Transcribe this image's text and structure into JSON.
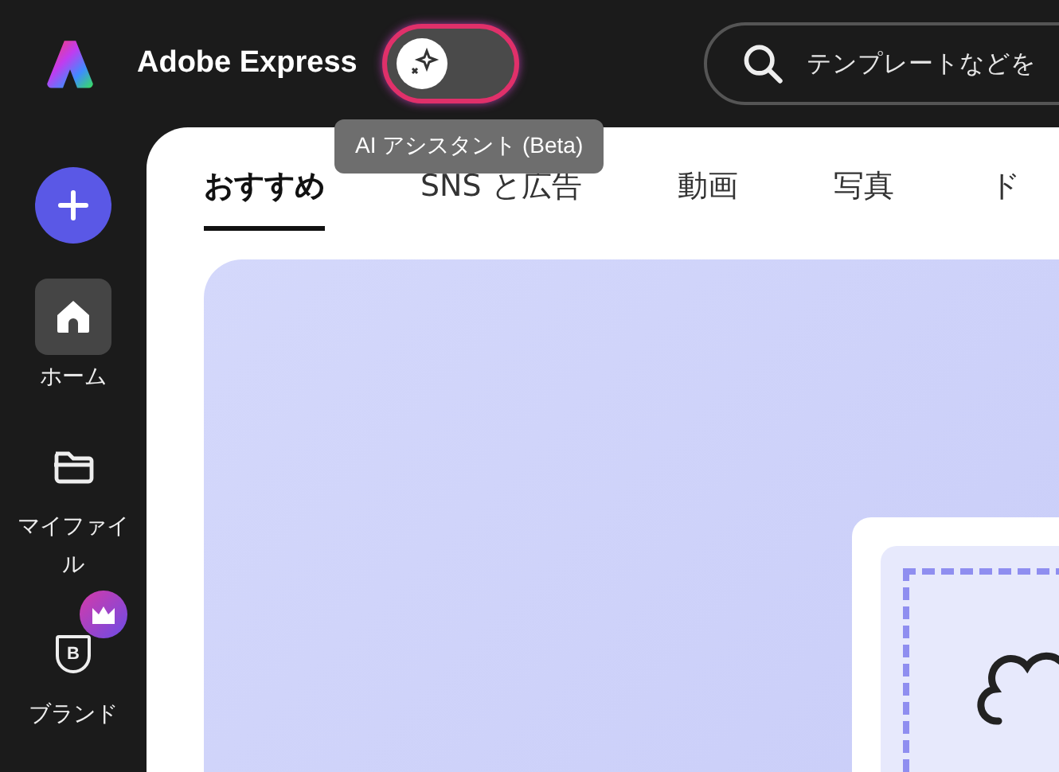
{
  "header": {
    "app_name": "Adobe Express",
    "ai_toggle": {
      "on": false
    },
    "ai_tooltip": "AI アシスタント (Beta)",
    "search": {
      "placeholder": "テンプレートなどを"
    }
  },
  "sidebar": {
    "items": [
      {
        "kind": "home",
        "label": "ホーム",
        "selected": true,
        "premium": false
      },
      {
        "kind": "files",
        "label": "マイファイル",
        "selected": false,
        "premium": false
      },
      {
        "kind": "brand",
        "icon_text": "B",
        "label": "ブランド",
        "selected": false,
        "premium": true
      }
    ]
  },
  "tabs": [
    {
      "label": "おすすめ",
      "selected": true
    },
    {
      "label": "SNS と広告",
      "selected": false
    },
    {
      "label": "動画",
      "selected": false
    },
    {
      "label": "写真",
      "selected": false
    },
    {
      "label": "ド",
      "selected": false
    }
  ]
}
